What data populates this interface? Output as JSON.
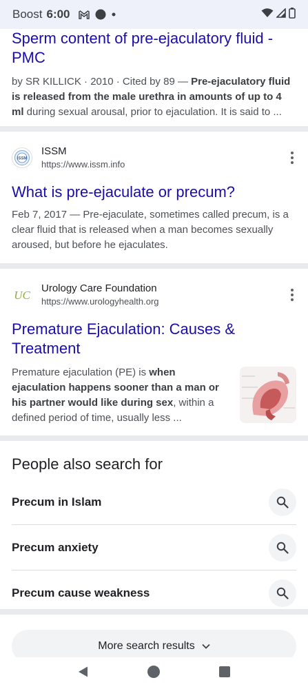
{
  "status_bar": {
    "carrier": "Boost",
    "time": "6:00"
  },
  "result1": {
    "title": "Sperm content of pre-ejaculatory fluid - PMC",
    "meta": "by SR KILLICK · 2010 · Cited by 89 — ",
    "bold": "Pre-ejaculatory fluid is released from the male urethra in amounts of up to 4 ml",
    "rest": " during sexual arousal, prior to ejaculation. It is said to ..."
  },
  "result2": {
    "source_name": "ISSM",
    "source_url": "https://www.issm.info",
    "favicon_text": "ISSM",
    "title": "What is pre-ejaculate or precum?",
    "snippet": "Feb 7, 2017 — Pre-ejaculate, sometimes called precum, is a clear fluid that is released when a man becomes sexually aroused, but before he ejaculates."
  },
  "result3": {
    "source_name": "Urology Care Foundation",
    "source_url": "https://www.urologyhealth.org",
    "favicon_text": "UC",
    "title": "Premature Ejaculation: Causes & Treatment",
    "snippet_pre": "Premature ejaculation (PE) is ",
    "snippet_bold": "when ejaculation happens sooner than a man or his partner would like during sex",
    "snippet_post": ", within a defined period of time, usually less ..."
  },
  "people_also_search": {
    "title": "People also search for",
    "items": [
      {
        "label": "Precum in Islam"
      },
      {
        "label": "Precum anxiety"
      },
      {
        "label": "Precum cause weakness"
      }
    ]
  },
  "more_results": {
    "label": "More search results"
  },
  "colors": {
    "link": "#1a0dab",
    "status_bg": "#eef1f9",
    "separator": "#e8eaed"
  }
}
